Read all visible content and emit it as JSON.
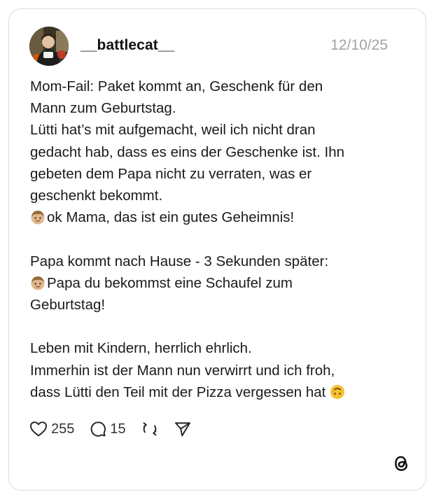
{
  "post": {
    "username": "__battlecat__",
    "date": "12/10/25",
    "lines": {
      "l1": "Mom-Fail: Paket kommt an, Geschenk für den",
      "l2": "Mann zum Geburtstag.",
      "l3": "Lütti hat’s mit aufgemacht, weil ich nicht dran",
      "l4": "gedacht hab, dass es eins der Geschenke ist. Ihn",
      "l5": "gebeten dem Papa nicht zu verraten, was er",
      "l6": "geschenkt bekommt.",
      "l7": "ok Mama, das ist ein gutes Geheimnis!",
      "l9": "Papa kommt nach Hause - 3 Sekunden später:",
      "l10": "Papa du bekommst eine Schaufel zum",
      "l11": "Geburtstag!",
      "l13": "Leben mit Kindern, herrlich ehrlich.",
      "l14": "Immerhin ist der Mann nun verwirrt und ich froh,",
      "l15": "dass Lütti den Teil mit der Pizza vergessen hat"
    },
    "emojis": [
      "boy-emoji",
      "boy-emoji",
      "upside-down-face-emoji"
    ]
  },
  "actions": {
    "likes": "255",
    "replies": "15",
    "icons": [
      "heart-icon",
      "comment-icon",
      "repost-icon",
      "share-icon"
    ]
  },
  "branding": {
    "logo": "threads-logo"
  },
  "colors": {
    "text": "#141414",
    "muted": "#a3a3a3",
    "border": "#dcdcdc",
    "emoji_skin": "#e0b88f",
    "emoji_hair": "#9a6a3c",
    "emoji_yellow": "#f6c030"
  }
}
